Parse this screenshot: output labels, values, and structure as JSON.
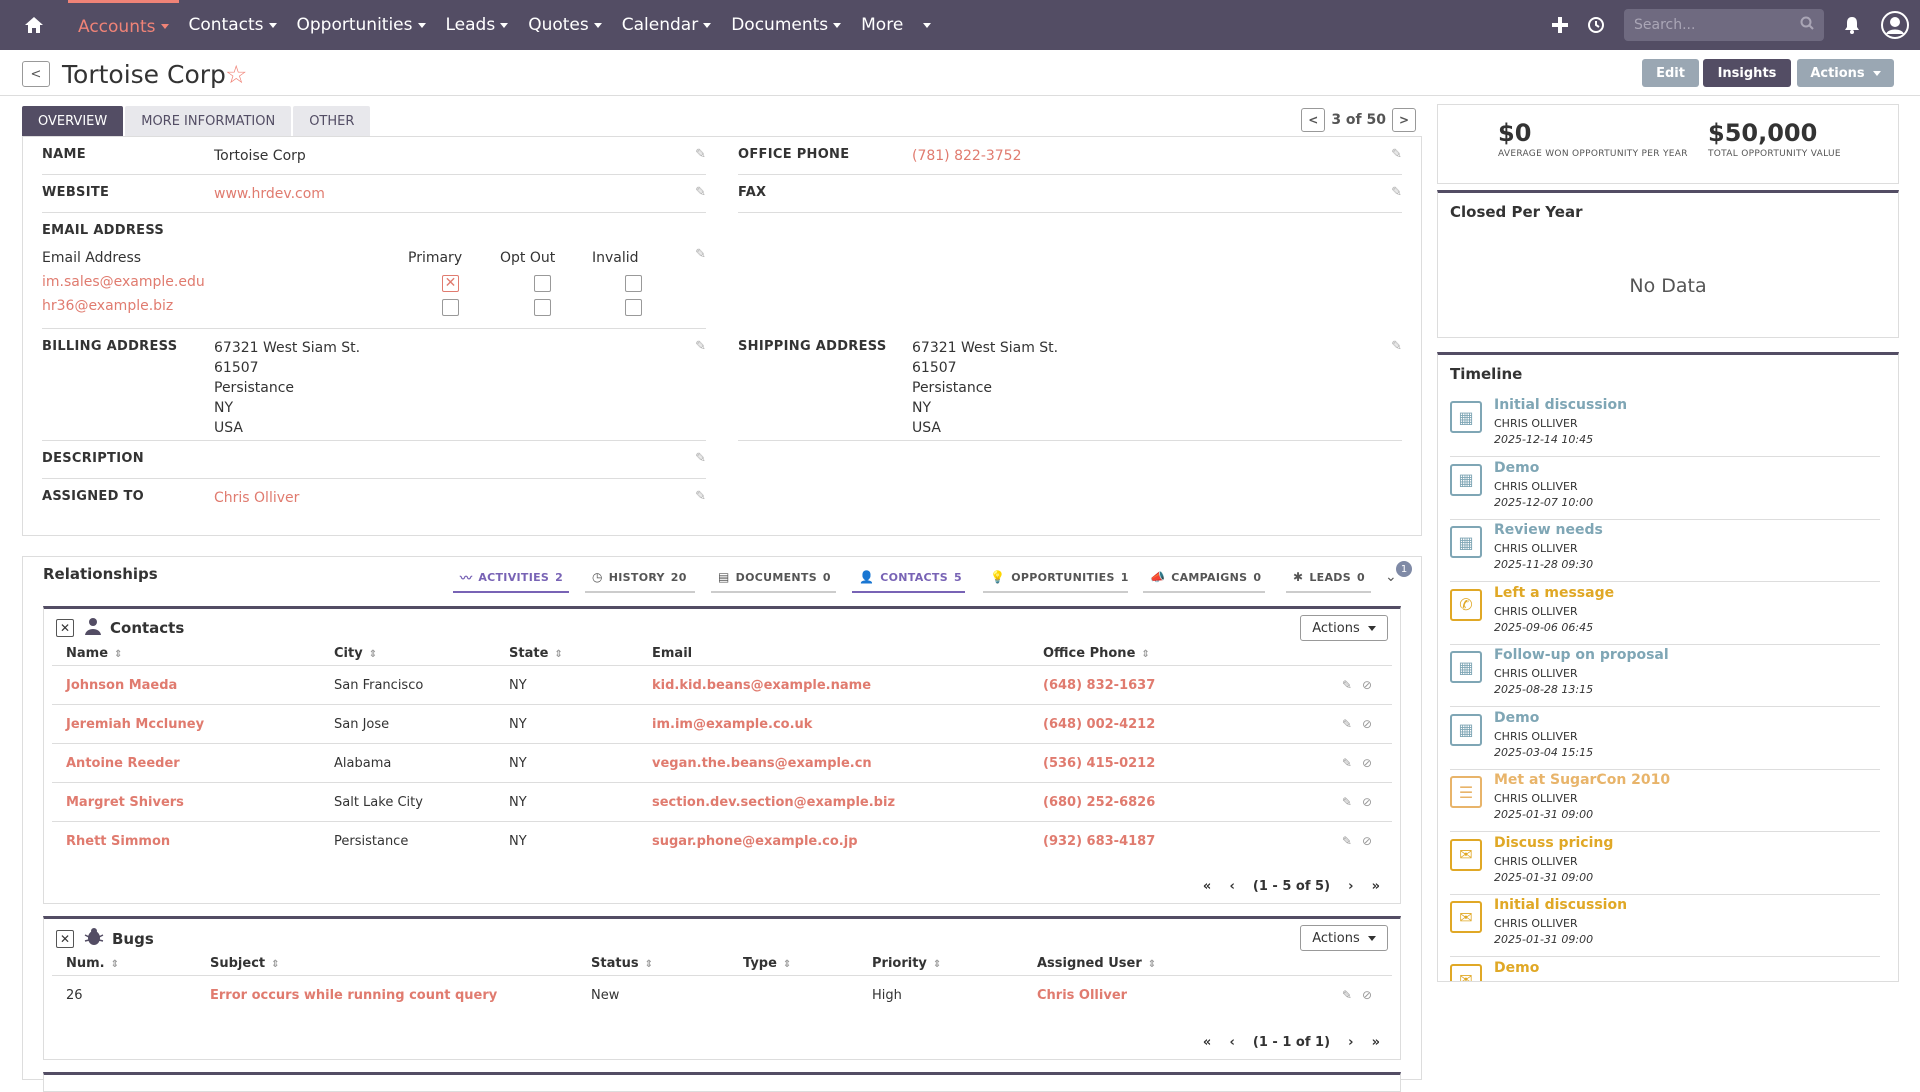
{
  "nav": {
    "items": [
      {
        "label": "Accounts",
        "active": true
      },
      {
        "label": "Contacts"
      },
      {
        "label": "Opportunities"
      },
      {
        "label": "Leads"
      },
      {
        "label": "Quotes"
      },
      {
        "label": "Calendar"
      },
      {
        "label": "Documents"
      },
      {
        "label": "More"
      }
    ],
    "search_placeholder": "Search..."
  },
  "header": {
    "back": "<",
    "title": "Tortoise Corp",
    "star": "☆",
    "edit": "Edit",
    "insights": "Insights",
    "actions": "Actions"
  },
  "detail": {
    "tabs": [
      "OVERVIEW",
      "MORE INFORMATION",
      "OTHER"
    ],
    "pager": {
      "prev": "<",
      "text": "3 of 50",
      "next": ">"
    },
    "name_label": "NAME",
    "name": "Tortoise Corp",
    "office_phone_label": "OFFICE PHONE",
    "office_phone": "(781) 822-3752",
    "website_label": "WEBSITE",
    "website": "www.hrdev.com",
    "fax_label": "FAX",
    "email_label": "EMAIL ADDRESS",
    "email_col": "Email Address",
    "primary_col": "Primary",
    "optout_col": "Opt Out",
    "invalid_col": "Invalid",
    "emails": [
      "im.sales@example.edu",
      "hr36@example.biz"
    ],
    "billing_label": "BILLING ADDRESS",
    "billing": [
      "67321 West Siam St.",
      "61507",
      "Persistance",
      "NY",
      "USA"
    ],
    "shipping_label": "SHIPPING ADDRESS",
    "shipping": [
      "67321 West Siam St.",
      "61507",
      "Persistance",
      "NY",
      "USA"
    ],
    "description_label": "DESCRIPTION",
    "assigned_label": "ASSIGNED TO",
    "assigned": "Chris Olliver"
  },
  "insights": {
    "avg_value": "$0",
    "avg_label": "AVERAGE WON OPPORTUNITY PER YEAR",
    "total_value": "$50,000",
    "total_label": "TOTAL OPPORTUNITY VALUE"
  },
  "closed": {
    "title": "Closed Per Year",
    "empty": "No Data"
  },
  "timeline": {
    "title": "Timeline",
    "items": [
      {
        "title": "Initial discussion",
        "user": "CHRIS OLLIVER",
        "date": "2025-12-14 10:45",
        "icon": "calendar-icon",
        "color": "#7fa6b5"
      },
      {
        "title": "Demo",
        "user": "CHRIS OLLIVER",
        "date": "2025-12-07 10:00",
        "icon": "calendar-icon",
        "color": "#7fa6b5"
      },
      {
        "title": "Review needs",
        "user": "CHRIS OLLIVER",
        "date": "2025-11-28 09:30",
        "icon": "calendar-icon",
        "color": "#7fa6b5"
      },
      {
        "title": "Left a message",
        "user": "CHRIS OLLIVER",
        "date": "2025-09-06 06:45",
        "icon": "phone-icon",
        "color": "#e0a826"
      },
      {
        "title": "Follow-up on proposal",
        "user": "CHRIS OLLIVER",
        "date": "2025-08-28 13:15",
        "icon": "calendar-icon",
        "color": "#7fa6b5"
      },
      {
        "title": "Demo",
        "user": "CHRIS OLLIVER",
        "date": "2025-03-04 15:15",
        "icon": "calendar-icon",
        "color": "#7fa6b5"
      },
      {
        "title": "Met at SugarCon 2010",
        "user": "CHRIS OLLIVER",
        "date": "2025-01-31 09:00",
        "icon": "note-icon",
        "color": "#e8b46a"
      },
      {
        "title": "Discuss pricing",
        "user": "CHRIS OLLIVER",
        "date": "2025-01-31 09:00",
        "icon": "email-icon",
        "color": "#e0a826"
      },
      {
        "title": "Initial discussion",
        "user": "CHRIS OLLIVER",
        "date": "2025-01-31 09:00",
        "icon": "email-icon",
        "color": "#e0a826"
      },
      {
        "title": "Demo",
        "user": "",
        "date": "",
        "icon": "email-icon",
        "color": "#e0a826"
      }
    ]
  },
  "relationships": {
    "title": "Relationships",
    "tabs": [
      {
        "label": "ACTIVITIES",
        "count": "2",
        "icon": "activity-icon",
        "active": true
      },
      {
        "label": "HISTORY",
        "count": "20",
        "icon": "history-icon"
      },
      {
        "label": "DOCUMENTS",
        "count": "0",
        "icon": "document-icon"
      },
      {
        "label": "CONTACTS",
        "count": "5",
        "icon": "contact-icon",
        "active": true
      },
      {
        "label": "OPPORTUNITIES",
        "count": "1",
        "icon": "bulb-icon"
      },
      {
        "label": "CAMPAIGNS",
        "count": "0",
        "icon": "megaphone-icon"
      },
      {
        "label": "LEADS",
        "count": "0",
        "icon": "leads-icon"
      }
    ],
    "more_badge": "1"
  },
  "contacts": {
    "title": "Contacts",
    "actions": "Actions",
    "columns": [
      "Name",
      "City",
      "State",
      "Email",
      "Office Phone"
    ],
    "rows": [
      [
        "Johnson Maeda",
        "San Francisco",
        "NY",
        "kid.kid.beans@example.name",
        "(648) 832-1637"
      ],
      [
        "Jeremiah Mccluney",
        "San Jose",
        "NY",
        "im.im@example.co.uk",
        "(648) 002-4212"
      ],
      [
        "Antoine Reeder",
        "Alabama",
        "NY",
        "vegan.the.beans@example.cn",
        "(536) 415-0212"
      ],
      [
        "Margret Shivers",
        "Salt Lake City",
        "NY",
        "section.dev.section@example.biz",
        "(680) 252-6826"
      ],
      [
        "Rhett Simmon",
        "Persistance",
        "NY",
        "sugar.phone@example.co.jp",
        "(932) 683-4187"
      ]
    ],
    "pagination": "(1 - 5 of 5)"
  },
  "bugs": {
    "title": "Bugs",
    "actions": "Actions",
    "columns": [
      "Num.",
      "Subject",
      "Status",
      "Type",
      "Priority",
      "Assigned User"
    ],
    "rows": [
      [
        "26",
        "Error occurs while running count query",
        "New",
        "",
        "High",
        "Chris Olliver"
      ]
    ],
    "pagination": "(1 - 1 of 1)"
  }
}
